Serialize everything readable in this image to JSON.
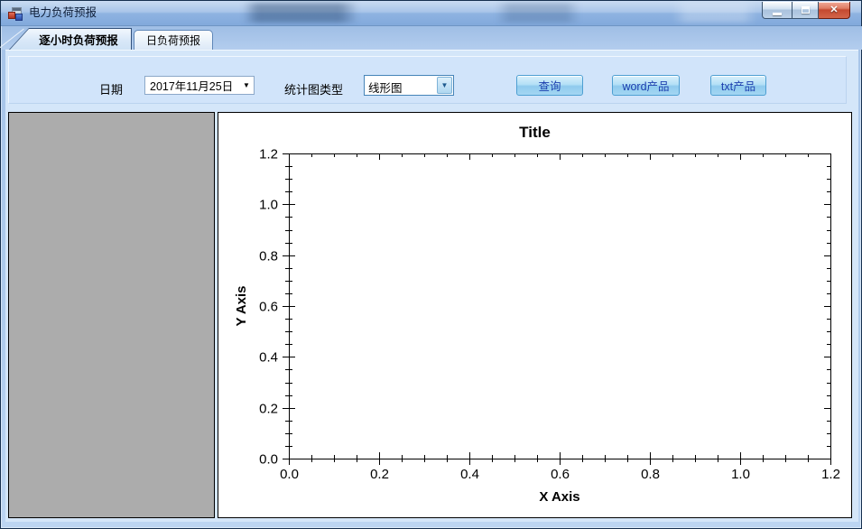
{
  "window": {
    "title": "电力负荷预报",
    "icon": "app-form-icon",
    "controls": {
      "close_glyph": "✕"
    }
  },
  "tabs": [
    {
      "label": "逐小时负荷预报",
      "active": true
    },
    {
      "label": "日负荷预报",
      "active": false
    }
  ],
  "toolbar": {
    "date_label": "日期",
    "date_value": "2017年11月25日",
    "chart_type_label": "统计图类型",
    "chart_type_value": "线形图",
    "buttons": [
      {
        "label": "查询"
      },
      {
        "label": "word产品"
      },
      {
        "label": "txt产品"
      }
    ]
  },
  "colors": {
    "accent_button_text": "#1D3FAE",
    "button_border": "#4E9FD2",
    "toolbar_panel": "#D1E4FA",
    "frame_blue": "#A6C4E8",
    "gray_panel": "#ACACAC",
    "close_red": "#C44930"
  },
  "chart_data": {
    "type": "line",
    "title": "Title",
    "xlabel": "X Axis",
    "ylabel": "Y Axis",
    "xlim": [
      0,
      1.2
    ],
    "ylim": [
      0,
      1.2
    ],
    "x_major_ticks": [
      0.0,
      0.2,
      0.4,
      0.6,
      0.8,
      1.0,
      1.2
    ],
    "y_major_ticks": [
      0.0,
      0.2,
      0.4,
      0.6,
      0.8,
      1.0,
      1.2
    ],
    "minor_tick_step": 0.05,
    "tick_label_decimals": 1,
    "grid": false,
    "legend": "none",
    "series": []
  }
}
